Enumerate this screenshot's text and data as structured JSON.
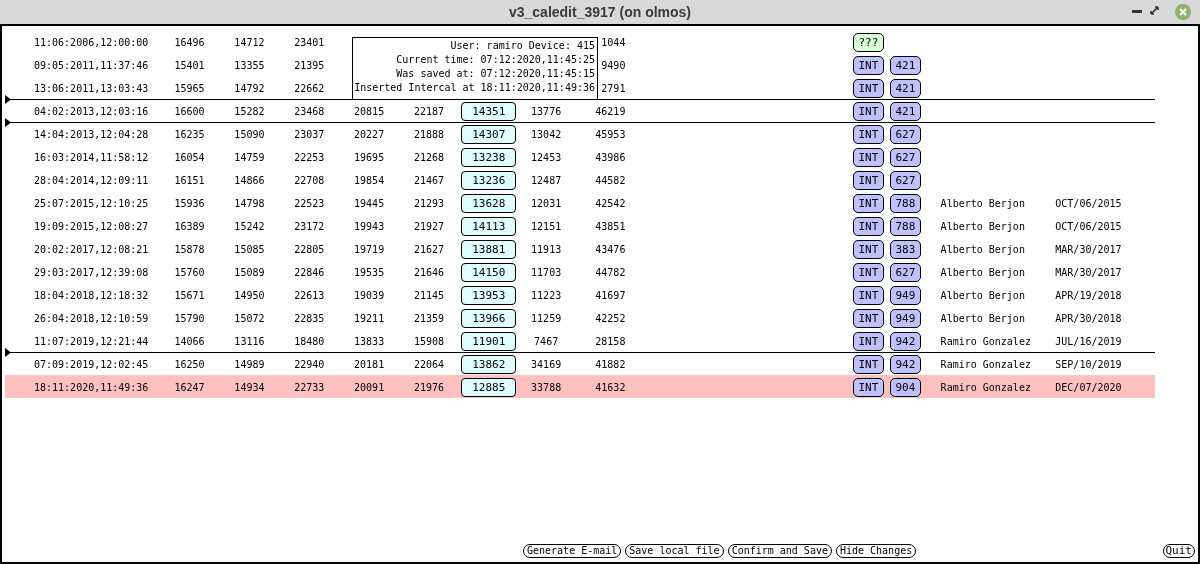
{
  "window": {
    "title": "v3_caledit_3917 (on olmos)"
  },
  "tooltip": {
    "lines": [
      "User: ramiro Device: 415",
      "Current time: 07:12:2020,11:45:25",
      "Was saved at: 07:12:2020,11:45:15",
      "Inserted Intercal at 18:11:2020,11:49:36"
    ]
  },
  "rows": [
    {
      "date": "11:06:2006,12:00:00",
      "values": [
        "16496",
        "14712",
        "23401"
      ],
      "column_9": "1044",
      "tags": [
        {
          "text": "???",
          "color": "#d8ffd8"
        }
      ],
      "separator_above": false,
      "selected": false
    },
    {
      "date": "09:05:2011,11:37:46",
      "values": [
        "15401",
        "13355",
        "21395"
      ],
      "column_9": "9490",
      "tags": [
        {
          "text": "INT",
          "color": "#c0c0ff"
        },
        {
          "text": "421",
          "color": "#c0c0ff"
        }
      ],
      "separator_above": false,
      "selected": false
    },
    {
      "date": "13:06:2011,13:03:43",
      "values": [
        "15965",
        "14792",
        "22662"
      ],
      "column_9": "2791",
      "tags": [
        {
          "text": "INT",
          "color": "#c0c0ff"
        },
        {
          "text": "421",
          "color": "#c0c0ff"
        }
      ],
      "separator_above": false,
      "selected": false
    },
    {
      "date": "04:02:2013,12:03:16",
      "values": [
        "16600",
        "15282",
        "23468",
        "20815",
        "22187"
      ],
      "boxed": "14351",
      "column_8": "13776",
      "column_9": "46219",
      "tags": [
        {
          "text": "INT",
          "color": "#c0c0ff"
        },
        {
          "text": "421",
          "color": "#c0c0ff"
        }
      ],
      "separator_above": true,
      "selected": false
    },
    {
      "date": "14:04:2013,12:04:28",
      "values": [
        "16235",
        "15090",
        "23037",
        "20227",
        "21888"
      ],
      "boxed": "14307",
      "column_8": "13042",
      "column_9": "45953",
      "tags": [
        {
          "text": "INT",
          "color": "#c0c0ff"
        },
        {
          "text": "627",
          "color": "#c0c0ff"
        }
      ],
      "separator_above": true,
      "selected": false
    },
    {
      "date": "16:03:2014,11:58:12",
      "values": [
        "16054",
        "14759",
        "22253",
        "19695",
        "21268"
      ],
      "boxed": "13238",
      "column_8": "12453",
      "column_9": "43986",
      "tags": [
        {
          "text": "INT",
          "color": "#c0c0ff"
        },
        {
          "text": "627",
          "color": "#c0c0ff"
        }
      ],
      "separator_above": false,
      "selected": false
    },
    {
      "date": "28:04:2014,12:09:11",
      "values": [
        "16151",
        "14866",
        "22708",
        "19854",
        "21467"
      ],
      "boxed": "13236",
      "column_8": "12487",
      "column_9": "44582",
      "tags": [
        {
          "text": "INT",
          "color": "#c0c0ff"
        },
        {
          "text": "627",
          "color": "#c0c0ff"
        }
      ],
      "separator_above": false,
      "selected": false
    },
    {
      "date": "25:07:2015,12:10:25",
      "values": [
        "15936",
        "14798",
        "22523",
        "19445",
        "21293"
      ],
      "boxed": "13628",
      "column_8": "12031",
      "column_9": "42542",
      "tags": [
        {
          "text": "INT",
          "color": "#c0c0ff"
        },
        {
          "text": "788",
          "color": "#c0c0ff"
        }
      ],
      "user": "Alberto Berjon",
      "user_date": "OCT/06/2015",
      "separator_above": false,
      "selected": false
    },
    {
      "date": "19:09:2015,12:08:27",
      "values": [
        "16389",
        "15242",
        "23172",
        "19943",
        "21927"
      ],
      "boxed": "14113",
      "column_8": "12151",
      "column_9": "43851",
      "tags": [
        {
          "text": "INT",
          "color": "#c0c0ff"
        },
        {
          "text": "788",
          "color": "#c0c0ff"
        }
      ],
      "user": "Alberto Berjon",
      "user_date": "OCT/06/2015",
      "separator_above": false,
      "selected": false
    },
    {
      "date": "20:02:2017,12:08:21",
      "values": [
        "15878",
        "15085",
        "22805",
        "19719",
        "21627"
      ],
      "boxed": "13881",
      "column_8": "11913",
      "column_9": "43476",
      "tags": [
        {
          "text": "INT",
          "color": "#c0c0ff"
        },
        {
          "text": "383",
          "color": "#c0c0ff"
        }
      ],
      "user": "Alberto Berjon",
      "user_date": "MAR/30/2017",
      "separator_above": false,
      "selected": false
    },
    {
      "date": "29:03:2017,12:39:08",
      "values": [
        "15760",
        "15089",
        "22846",
        "19535",
        "21646"
      ],
      "boxed": "14150",
      "column_8": "11703",
      "column_9": "44782",
      "tags": [
        {
          "text": "INT",
          "color": "#c0c0ff"
        },
        {
          "text": "627",
          "color": "#c0c0ff"
        }
      ],
      "user": "Alberto Berjon",
      "user_date": "MAR/30/2017",
      "separator_above": false,
      "selected": false
    },
    {
      "date": "18:04:2018,12:18:32",
      "values": [
        "15671",
        "14950",
        "22613",
        "19039",
        "21145"
      ],
      "boxed": "13953",
      "column_8": "11223",
      "column_9": "41697",
      "tags": [
        {
          "text": "INT",
          "color": "#c0c0ff"
        },
        {
          "text": "949",
          "color": "#c0c0ff"
        }
      ],
      "user": "Alberto Berjon",
      "user_date": "APR/19/2018",
      "separator_above": false,
      "selected": false
    },
    {
      "date": "26:04:2018,12:10:59",
      "values": [
        "15790",
        "15072",
        "22835",
        "19211",
        "21359"
      ],
      "boxed": "13966",
      "column_8": "11259",
      "column_9": "42252",
      "tags": [
        {
          "text": "INT",
          "color": "#c0c0ff"
        },
        {
          "text": "949",
          "color": "#c0c0ff"
        }
      ],
      "user": "Alberto Berjon",
      "user_date": "APR/30/2018",
      "separator_above": false,
      "selected": false
    },
    {
      "date": "11:07:2019,12:21:44",
      "values": [
        "14066",
        "13116",
        "18480",
        "13833",
        "15908"
      ],
      "boxed": "11901",
      "column_8": "7467",
      "column_9": "28158",
      "tags": [
        {
          "text": "INT",
          "color": "#c0c0ff"
        },
        {
          "text": "942",
          "color": "#c0c0ff"
        }
      ],
      "user": "Ramiro Gonzalez",
      "user_date": "JUL/16/2019",
      "separator_above": false,
      "selected": false
    },
    {
      "date": "07:09:2019,12:02:45",
      "values": [
        "16250",
        "14989",
        "22940",
        "20181",
        "22064"
      ],
      "boxed": "13862",
      "column_8": "34169",
      "column_9": "41882",
      "tags": [
        {
          "text": "INT",
          "color": "#c0c0ff"
        },
        {
          "text": "942",
          "color": "#c0c0ff"
        }
      ],
      "user": "Ramiro Gonzalez",
      "user_date": "SEP/10/2019",
      "separator_above": true,
      "selected": false
    },
    {
      "date": "18:11:2020,11:49:36",
      "values": [
        "16247",
        "14934",
        "22733",
        "20091",
        "21976"
      ],
      "boxed": "12885",
      "column_8": "33788",
      "column_9": "41632",
      "tags": [
        {
          "text": "INT",
          "color": "#c0c0ff"
        },
        {
          "text": "904",
          "color": "#c0c0ff"
        }
      ],
      "user": "Ramiro Gonzalez",
      "user_date": "DEC/07/2020",
      "separator_above": false,
      "selected": true
    }
  ],
  "buttons": [
    "Generate E-mail",
    "Save local file",
    "Confirm and Save",
    "Hide Changes"
  ],
  "quit_button": "Quit"
}
